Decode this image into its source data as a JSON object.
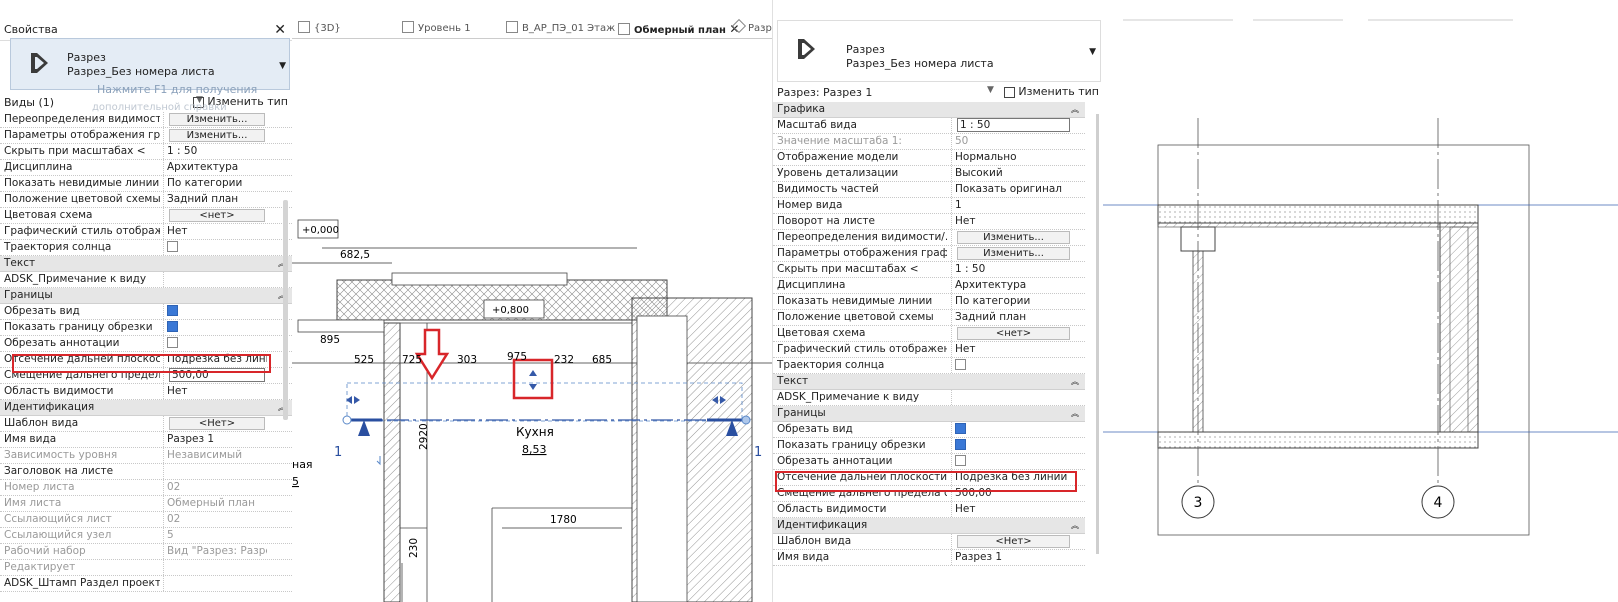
{
  "left_panel": {
    "title": "Свойства",
    "type_name": "Разрез",
    "type_sub": "Разрез_Без номера листа",
    "tooltip_line1": "Нажмите F1 для получения",
    "tooltip_line2": "дополнительной справки",
    "views_label": "Виды (1)",
    "edit_type": "Изменить тип",
    "rows": [
      {
        "k": "Переопределения видимости/...",
        "btn": "Изменить..."
      },
      {
        "k": "Параметры отображения граф...",
        "btn": "Изменить..."
      },
      {
        "k": "Скрыть при масштабах <",
        "v": "1 : 50"
      },
      {
        "k": "Дисциплина",
        "v": "Архитектура"
      },
      {
        "k": "Показать невидимые линии",
        "v": "По категории"
      },
      {
        "k": "Положение цветовой схемы",
        "v": "Задний план"
      },
      {
        "k": "Цветовая схема",
        "btn": "<нет>"
      },
      {
        "k": "Графический стиль отображен...",
        "v": "Нет"
      },
      {
        "k": "Траектория солнца",
        "cb": false
      },
      {
        "cat": "Текст"
      },
      {
        "k": "ADSK_Примечание к виду",
        "v": ""
      },
      {
        "cat": "Границы"
      },
      {
        "k": "Обрезать вид",
        "cb": true
      },
      {
        "k": "Показать границу обрезки",
        "cb": true
      },
      {
        "k": "Обрезать аннотации",
        "cb": false
      },
      {
        "k": "Отсечение дальней плоскости",
        "v": "Подрезка без линии"
      },
      {
        "k": "Смещение дальнего предела с...",
        "inp": "500,00"
      },
      {
        "k": "Область видимости",
        "v": "Нет"
      },
      {
        "cat": "Идентификация"
      },
      {
        "k": "Шаблон вида",
        "btn": "<Нет>"
      },
      {
        "k": "Имя вида",
        "v": "Разрез 1"
      },
      {
        "k": "Зависимость уровня",
        "v": "Независимый",
        "dis": true
      },
      {
        "k": "Заголовок на листе",
        "v": ""
      },
      {
        "k": "Номер листа",
        "v": "02",
        "dis": true
      },
      {
        "k": "Имя листа",
        "v": "Обмерный план",
        "dis": true
      },
      {
        "k": "Ссылающийся лист",
        "v": "02",
        "dis": true
      },
      {
        "k": "Ссылающийся узел",
        "v": "5",
        "dis": true
      },
      {
        "k": "Рабочий набор",
        "v": "Вид \"Разрез: Разрез 1\"",
        "dis": true
      },
      {
        "k": "Редактирует",
        "v": "",
        "dis": true
      },
      {
        "k": "ADSK_Штамп Раздел проекта",
        "v": ""
      }
    ]
  },
  "tabs": [
    {
      "label": "{3D}"
    },
    {
      "label": "Уровень 1"
    },
    {
      "label": "В_АР_ПЭ_01 Этаж"
    },
    {
      "label": "Обмерный план",
      "active": true,
      "close": "✕"
    },
    {
      "label": "Разр"
    }
  ],
  "plan": {
    "level_tag": "+0,000",
    "floor_tag": "+0,800",
    "room_name": "Кухня",
    "room_area": "8,53",
    "dims": {
      "d6825": "682,5",
      "d895": "895",
      "d525": "525",
      "d725": "725",
      "d303": "303",
      "d975": "975",
      "d232": "232",
      "d685": "685",
      "d2920": "2920",
      "d1780": "1780",
      "d230": "230"
    },
    "section_mark_left": "1",
    "section_mark_right": "1",
    "partial_left_1": "ная",
    "partial_left_2": "5"
  },
  "right_panel": {
    "type_name": "Разрез",
    "type_sub": "Разрез_Без номера листа",
    "views_label": "Разрез: Разрез 1",
    "edit_type": "Изменить тип",
    "rows": [
      {
        "cat": "Графика"
      },
      {
        "k": "Масштаб вида",
        "inp": "1 : 50"
      },
      {
        "k": "Значение масштаба    1:",
        "v": "50",
        "dis": true
      },
      {
        "k": "Отображение модели",
        "v": "Нормально"
      },
      {
        "k": "Уровень детализации",
        "v": "Высокий"
      },
      {
        "k": "Видимость частей",
        "v": "Показать оригинал"
      },
      {
        "k": "Номер вида",
        "v": "1"
      },
      {
        "k": "Поворот на листе",
        "v": "Нет"
      },
      {
        "k": "Переопределения видимости/...",
        "btn": "Изменить..."
      },
      {
        "k": "Параметры отображения граф...",
        "btn": "Изменить..."
      },
      {
        "k": "Скрыть при масштабах <",
        "v": "1 : 50"
      },
      {
        "k": "Дисциплина",
        "v": "Архитектура"
      },
      {
        "k": "Показать невидимые линии",
        "v": "По категории"
      },
      {
        "k": "Положение цветовой схемы",
        "v": "Задний план"
      },
      {
        "k": "Цветовая схема",
        "btn": "<нет>"
      },
      {
        "k": "Графический стиль отображен...",
        "v": "Нет"
      },
      {
        "k": "Траектория солнца",
        "cb": false
      },
      {
        "cat": "Текст"
      },
      {
        "k": "ADSK_Примечание к виду",
        "v": ""
      },
      {
        "cat": "Границы"
      },
      {
        "k": "Обрезать вид",
        "cb": true
      },
      {
        "k": "Показать границу обрезки",
        "cb": true
      },
      {
        "k": "Обрезать аннотации",
        "cb": false
      },
      {
        "k": "Отсечение дальней плоскости",
        "v": "Подрезка без линии"
      },
      {
        "k": "Смещение дальнего предела с...",
        "v": "500,00"
      },
      {
        "k": "Область видимости",
        "v": "Нет"
      },
      {
        "cat": "Идентификация"
      },
      {
        "k": "Шаблон вида",
        "btn": "<Нет>"
      },
      {
        "k": "Имя вида",
        "v": "Разрез 1"
      }
    ]
  },
  "section_view": {
    "grid_left": "3",
    "grid_right": "4"
  }
}
